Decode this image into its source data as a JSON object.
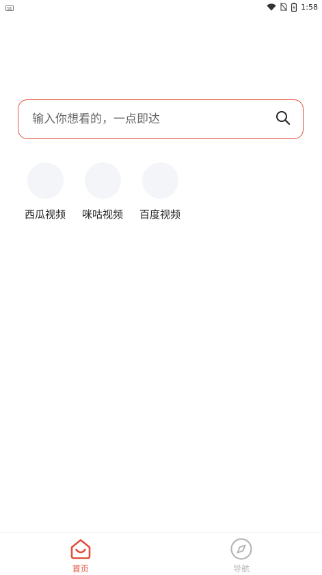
{
  "status_bar": {
    "time": "1:58"
  },
  "search": {
    "placeholder": "输入你想看的，一点即达",
    "value": ""
  },
  "shortcuts": [
    {
      "label": "西瓜视频"
    },
    {
      "label": "咪咕视频"
    },
    {
      "label": "百度视频"
    }
  ],
  "bottom_nav": {
    "home_label": "首页",
    "nav_label": "导航"
  },
  "colors": {
    "accent": "#e0503c",
    "inactive": "#b5b5b5",
    "shortcut_bg": "#f4f5f9"
  }
}
